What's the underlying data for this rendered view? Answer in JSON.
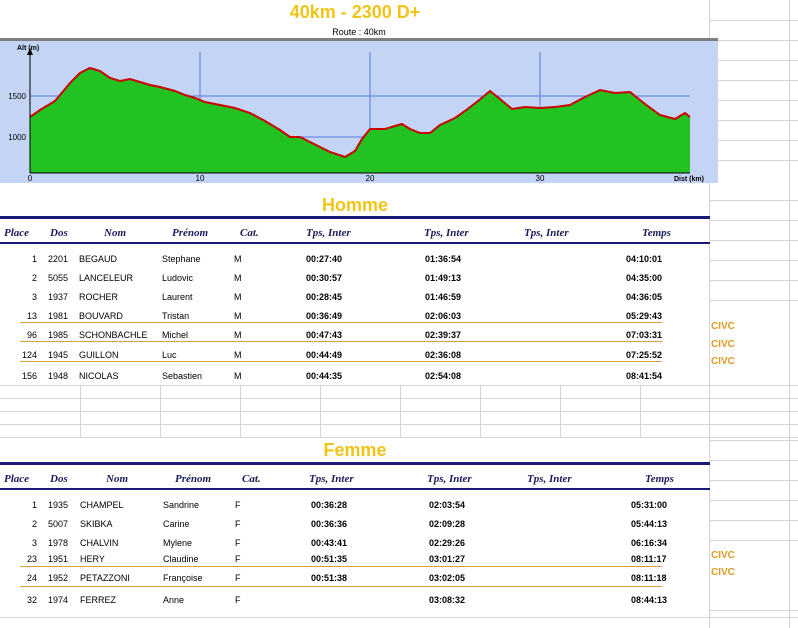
{
  "title": "40km - 2300 D+",
  "profile": {
    "route_label": "Route : 40km",
    "y_axis_label": "Alt (m)",
    "x_axis_label": "Dist (km)",
    "y_ticks": [
      "1500",
      "1000"
    ],
    "x_ticks": [
      "0",
      "10",
      "20",
      "30"
    ],
    "fill_color": "#22c222",
    "line_color": "#cc0000",
    "bg_color": "#c4d4f4"
  },
  "columns": {
    "place": "Place",
    "dos": "Dos",
    "nom": "Nom",
    "prenom": "Prénom",
    "cat": "Cat.",
    "inter1": "Tps, Inter",
    "inter2": "Tps, Inter",
    "inter3": "Tps, Inter",
    "temps": "Temps"
  },
  "homme": {
    "title": "Homme",
    "rows": [
      {
        "place": "1",
        "dos": "2201",
        "nom": "BEGAUD",
        "prenom": "Stephane",
        "cat": "M",
        "inter1": "00:27:40",
        "inter2": "01:36:54",
        "temps": "04:10:01",
        "club": ""
      },
      {
        "place": "2",
        "dos": "5055",
        "nom": "LANCELEUR",
        "prenom": "Ludovic",
        "cat": "M",
        "inter1": "00:30:57",
        "inter2": "01:49:13",
        "temps": "04:35:00",
        "club": ""
      },
      {
        "place": "3",
        "dos": "1937",
        "nom": "ROCHER",
        "prenom": "Laurent",
        "cat": "M",
        "inter1": "00:28:45",
        "inter2": "01:46:59",
        "temps": "04:36:05",
        "club": ""
      },
      {
        "place": "13",
        "dos": "1981",
        "nom": "BOUVARD",
        "prenom": "Tristan",
        "cat": "M",
        "inter1": "00:36:49",
        "inter2": "02:06:03",
        "temps": "05:29:43",
        "club": "CIVC"
      },
      {
        "place": "96",
        "dos": "1985",
        "nom": "SCHONBACHLE",
        "prenom": "Michel",
        "cat": "M",
        "inter1": "00:47:43",
        "inter2": "02:39:37",
        "temps": "07:03:31",
        "club": "CIVC"
      },
      {
        "place": "124",
        "dos": "1945",
        "nom": "GUILLON",
        "prenom": "Luc",
        "cat": "M",
        "inter1": "00:44:49",
        "inter2": "02:36:08",
        "temps": "07:25:52",
        "club": "CIVC"
      },
      {
        "place": "156",
        "dos": "1948",
        "nom": "NICOLAS",
        "prenom": "Sebastien",
        "cat": "M",
        "inter1": "00:44:35",
        "inter2": "02:54:08",
        "temps": "08:41:54",
        "club": ""
      }
    ]
  },
  "femme": {
    "title": "Femme",
    "rows": [
      {
        "place": "1",
        "dos": "1935",
        "nom": "CHAMPEL",
        "prenom": "Sandrine",
        "cat": "F",
        "inter1": "00:36:28",
        "inter2": "02:03:54",
        "temps": "05:31:00",
        "club": ""
      },
      {
        "place": "2",
        "dos": "5007",
        "nom": "SKIBKA",
        "prenom": "Carine",
        "cat": "F",
        "inter1": "00:36:36",
        "inter2": "02:09:28",
        "temps": "05:44:13",
        "club": ""
      },
      {
        "place": "3",
        "dos": "1978",
        "nom": "CHALVIN",
        "prenom": "Mylene",
        "cat": "F",
        "inter1": "00:43:41",
        "inter2": "02:29:26",
        "temps": "06:16:34",
        "club": ""
      },
      {
        "place": "23",
        "dos": "1951",
        "nom": "HERY",
        "prenom": "Claudine",
        "cat": "F",
        "inter1": "00:51:35",
        "inter2": "03:01:27",
        "temps": "08:11:17",
        "club": "CIVC"
      },
      {
        "place": "24",
        "dos": "1952",
        "nom": "PETAZZONI",
        "prenom": "Françoise",
        "cat": "F",
        "inter1": "00:51:38",
        "inter2": "03:02:05",
        "temps": "08:11:18",
        "club": "CIVC"
      },
      {
        "place": "32",
        "dos": "1974",
        "nom": "FERREZ",
        "prenom": "Anne",
        "cat": "F",
        "inter1": "",
        "inter2": "03:08:32",
        "temps": "08:44:13",
        "club": ""
      }
    ]
  }
}
